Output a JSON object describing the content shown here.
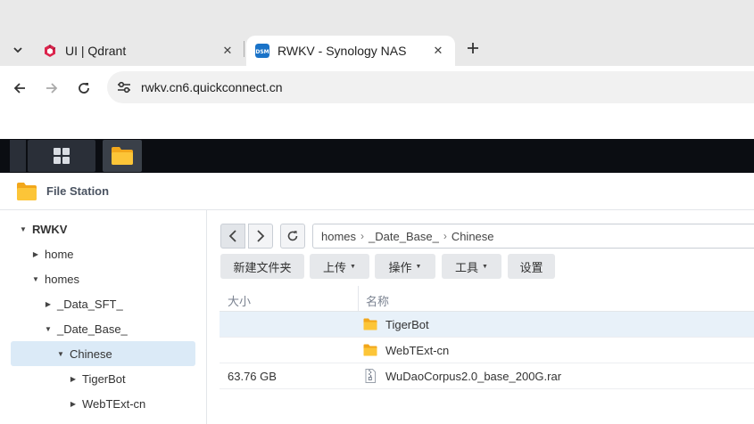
{
  "browser": {
    "tabs": [
      {
        "title": "UI | Qdrant",
        "active": false,
        "favicon": "qdrant-icon"
      },
      {
        "title": "RWKV - Synology NAS",
        "active": true,
        "favicon": "dsm-icon"
      }
    ],
    "url": "rwkv.cn6.quickconnect.cn",
    "accent_color": "#1a73e8"
  },
  "app": {
    "title": "File Station",
    "icon": "folder-icon"
  },
  "sidebar": {
    "items": [
      {
        "label": "RWKV",
        "expanded": true,
        "selected": false
      },
      {
        "label": "home",
        "expanded": false,
        "selected": false
      },
      {
        "label": "homes",
        "expanded": true,
        "selected": false
      },
      {
        "label": "_Data_SFT_",
        "expanded": false,
        "selected": false
      },
      {
        "label": "_Date_Base_",
        "expanded": true,
        "selected": false
      },
      {
        "label": "Chinese",
        "expanded": true,
        "selected": true
      },
      {
        "label": "TigerBot",
        "expanded": false,
        "selected": false
      },
      {
        "label": "WebTExt-cn",
        "expanded": false,
        "selected": false
      }
    ]
  },
  "path": [
    "homes",
    "_Date_Base_",
    "Chinese"
  ],
  "toolbar": {
    "new_folder": "新建文件夹",
    "upload": "上传",
    "action": "操作",
    "tools": "工具",
    "settings": "设置"
  },
  "list": {
    "headers": {
      "size": "大小",
      "name": "名称"
    },
    "rows": [
      {
        "size": "",
        "name": "TigerBot",
        "type": "folder"
      },
      {
        "size": "",
        "name": "WebTExt-cn",
        "type": "folder"
      },
      {
        "size": "63.76 GB",
        "name": "WuDaoCorpus2.0_base_200G.rar",
        "type": "archive"
      }
    ]
  }
}
